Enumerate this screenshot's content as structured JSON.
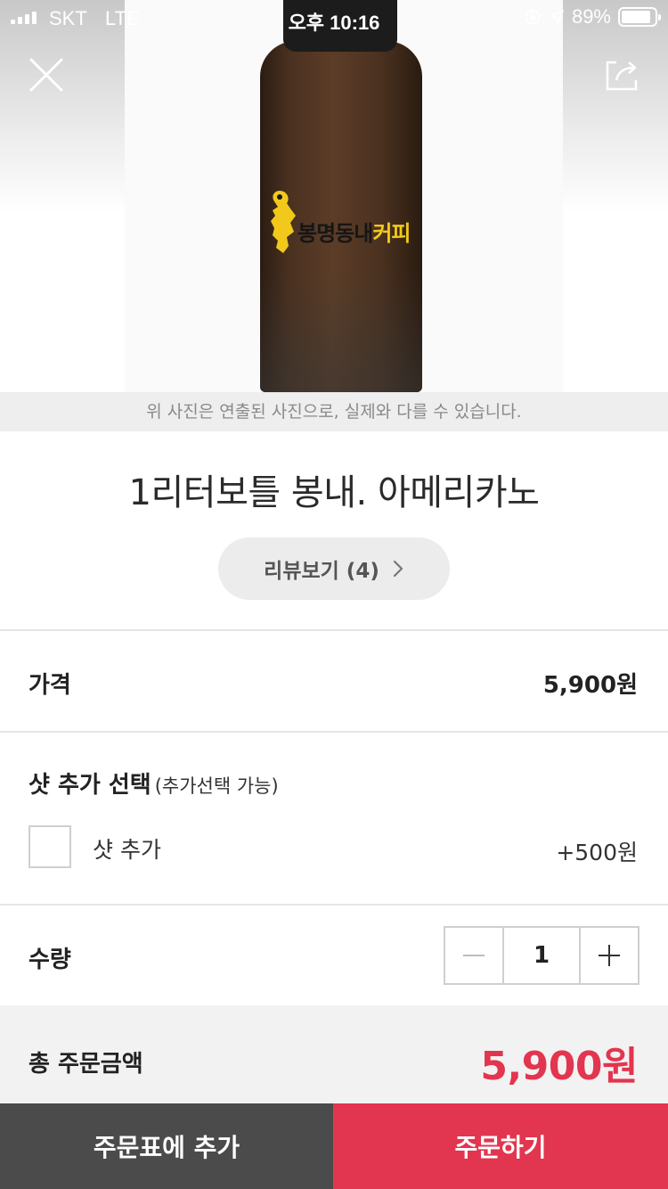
{
  "status_bar": {
    "carrier": "SKT",
    "network": "LTE",
    "time": "오후 10:16",
    "battery": "89%",
    "battery_level": 0.89,
    "icons": [
      "signal-bars-icon",
      "orientation-lock-icon",
      "location-arrow-icon",
      "battery-icon"
    ]
  },
  "header": {
    "close_icon": "close-icon",
    "share_icon": "share-icon"
  },
  "photo": {
    "note": "위 사진은 연출된 사진으로, 실제와 다를 수 있습니다.",
    "logo_text_main": "봉명동내",
    "logo_text_accent": "커피",
    "logo_accent_color": "#f2c91b"
  },
  "product": {
    "title": "1리터보틀 봉내. 아메리카노",
    "review_label": "리뷰보기 (4)",
    "review_chevron_icon": "chevron-right-icon"
  },
  "price": {
    "label": "가격",
    "value": "5,900원"
  },
  "options": {
    "title": "샷 추가 선택",
    "subtitle": "(추가선택 가능)",
    "items": [
      {
        "label": "샷 추가",
        "price": "+500원",
        "checked": false
      }
    ]
  },
  "quantity": {
    "label": "수량",
    "value": "1",
    "minus_icon": "minus-icon",
    "plus_icon": "plus-icon"
  },
  "total": {
    "label": "총 주문금액",
    "value": "5,900원"
  },
  "actions": {
    "add_to_cart": "주문표에 추가",
    "order": "주문하기"
  },
  "colors": {
    "accent": "#e2354f",
    "dark_button": "#4b4b4b",
    "divider": "#e6e6e6"
  }
}
